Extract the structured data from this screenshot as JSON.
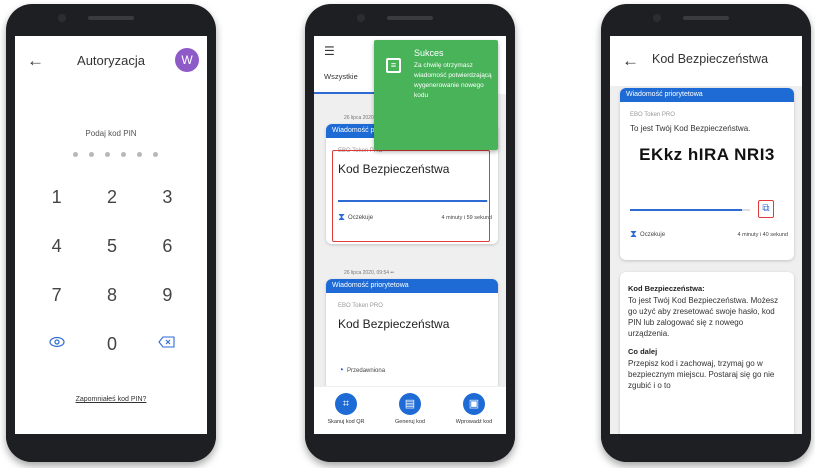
{
  "colors": {
    "accent": "#1e6bd6",
    "success": "#49b35a",
    "avatar": "#8e5ac7",
    "highlight": "#e03a3a"
  },
  "phone1": {
    "title": "Autoryzacja",
    "avatar_letter": "W",
    "pin_label": "Podaj kod PIN",
    "keys": [
      "1",
      "2",
      "3",
      "4",
      "5",
      "6",
      "7",
      "8",
      "9"
    ],
    "key_zero": "0",
    "key_biometric_icon": "fingerprint-icon",
    "key_delete_icon": "backspace-icon",
    "forgot_link": "Zapomniałeś kod PIN?"
  },
  "phone2": {
    "tab_all": "Wszystkie",
    "toast": {
      "title": "Sukces",
      "body": "Za chwilę otrzymasz wiadomość potwierdzającą wygenerowanie nowego kodu"
    },
    "date1": "26 lipca 2020, 09:54 ••",
    "card1": {
      "header": "Wiadomość priorytetowa",
      "source": "EBO Token PRO",
      "title": "Kod Bezpieczeństwa",
      "status": "Oczekuje",
      "time_left": "4 minuty i 59 sekund",
      "progress": 0.99
    },
    "date2": "26 lipca 2020, 09:54 ••",
    "card2": {
      "header": "Wiadomość priorytetowa",
      "source": "EBO Token PRO",
      "title": "Kod Bezpieczeństwa",
      "status": "Przedawniona"
    },
    "bottom": [
      {
        "label": "Skanuj kod QR",
        "icon": "qr-scan-icon"
      },
      {
        "label": "Generuj kod",
        "icon": "generate-code-icon"
      },
      {
        "label": "Wprowadź kod",
        "icon": "enter-code-icon"
      }
    ]
  },
  "phone3": {
    "title": "Kod Bezpieczeństwa",
    "card_header": "Wiadomość priorytetowa",
    "source": "EBO Token PRO",
    "subtitle": "To jest Twój Kod Bezpieczeństwa.",
    "code": "EKkz hIRA NRI3",
    "status": "Oczekuje",
    "time_left": "4 minuty i 40 sekund",
    "progress": 0.93,
    "info": {
      "heading1": "Kod Bezpieczeństwa:",
      "text1": "To jest Twój Kod Bezpieczeństwa. Możesz go użyć aby zresetować swoje hasło, kod PIN lub zalogować się z nowego urządzenia.",
      "heading2": "Co dalej",
      "text2": "Przepisz kod i zachowaj, trzymaj go w bezpiecznym miejscu. Postaraj się go nie zgubić i o to"
    }
  }
}
